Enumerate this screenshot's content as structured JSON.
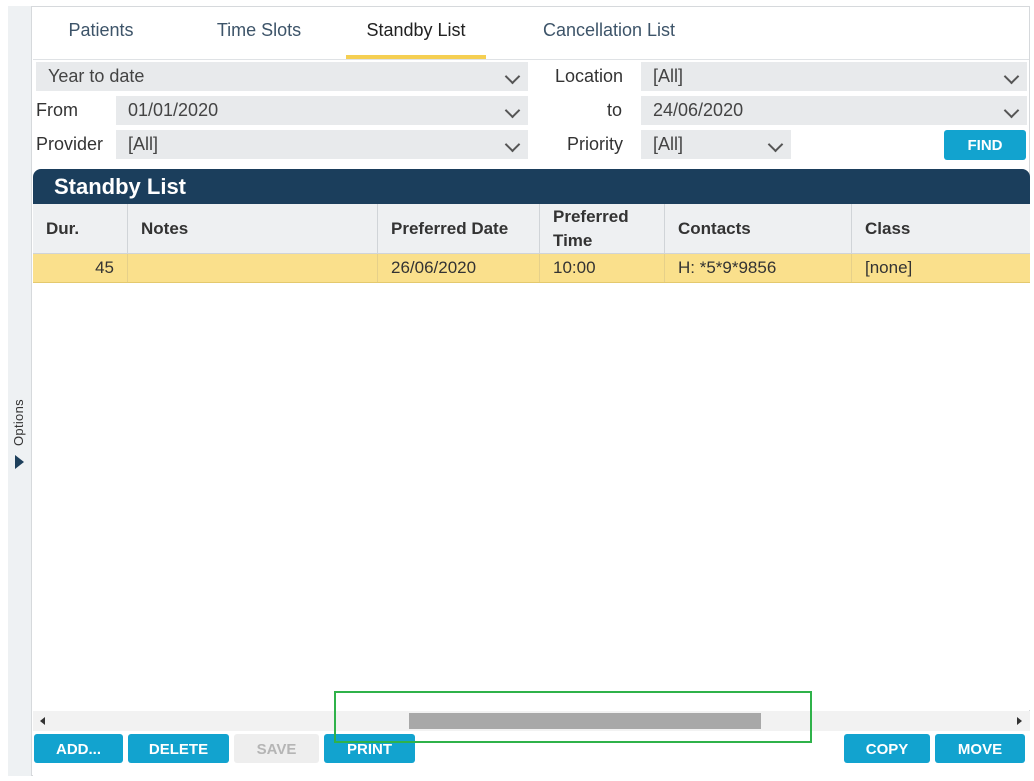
{
  "sidebar": {
    "options_label": "Options"
  },
  "tabs": [
    {
      "label": "Patients"
    },
    {
      "label": "Time Slots"
    },
    {
      "label": "Standby List"
    },
    {
      "label": "Cancellation List"
    }
  ],
  "active_tab": "Standby List",
  "filters": {
    "period": "Year to date",
    "location_label": "Location",
    "location_value": "[All]",
    "from_label": "From",
    "from_value": "01/01/2020",
    "to_label": "to",
    "to_value": "24/06/2020",
    "provider_label": "Provider",
    "provider_value": "[All]",
    "priority_label": "Priority",
    "priority_value": "[All]",
    "find_button": "FIND"
  },
  "panel": {
    "title": "Standby List",
    "columns": [
      "Dur.",
      "Notes",
      "Preferred Date",
      "Preferred Time",
      "Contacts",
      "Class"
    ],
    "rows": [
      {
        "dur": "45",
        "notes": "",
        "preferred_date": "26/06/2020",
        "preferred_time": "10:00",
        "contacts": "H: *5*9*9856",
        "class": "[none]"
      }
    ]
  },
  "actions": {
    "add": "ADD...",
    "delete": "DELETE",
    "save": "SAVE",
    "print": "PRINT",
    "copy": "COPY",
    "move": "MOVE"
  },
  "colors": {
    "accent": "#12a3cf",
    "header": "#1b3e5c",
    "selected_row": "#fae08c",
    "tab_underline": "#f5cf52",
    "highlight_box": "#2fb24a"
  }
}
